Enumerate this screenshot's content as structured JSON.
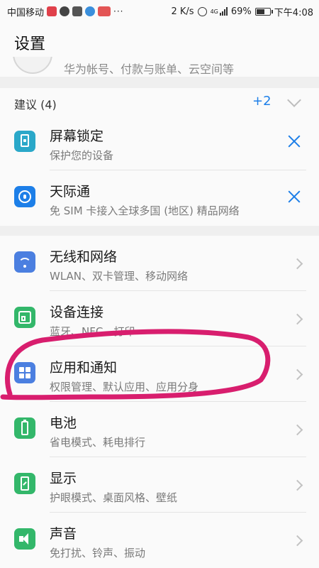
{
  "status_bar": {
    "carrier": "中国移动",
    "speed": "2 K/s",
    "network": "4G",
    "battery": "69%",
    "battery_level": 0.69,
    "time": "下午4:08",
    "more": "···"
  },
  "header": {
    "title": "设置"
  },
  "account": {
    "subtitle": "华为帐号、付款与账单、云空间等"
  },
  "suggestions": {
    "title": "建议 (4)",
    "more_label": "+2",
    "items": [
      {
        "title": "屏幕锁定",
        "subtitle": "保护您的设备",
        "icon": "screen-lock-icon",
        "color": "#2aa8c9"
      },
      {
        "title": "天际通",
        "subtitle": "免 SIM 卡接入全球多国 (地区) 精品网络",
        "icon": "globe-icon",
        "color": "#1d7fe8"
      }
    ]
  },
  "settings": {
    "items": [
      {
        "title": "无线和网络",
        "subtitle": "WLAN、双卡管理、移动网络",
        "icon": "wifi-icon",
        "color": "#4b7fe0"
      },
      {
        "title": "设备连接",
        "subtitle": "蓝牙、NFC、打印",
        "icon": "device-connection-icon",
        "color": "#33b76a"
      },
      {
        "title": "应用和通知",
        "subtitle": "权限管理、默认应用、应用分身",
        "icon": "apps-icon",
        "color": "#4b7fe0"
      },
      {
        "title": "电池",
        "subtitle": "省电模式、耗电排行",
        "icon": "battery-icon",
        "color": "#33b76a"
      },
      {
        "title": "显示",
        "subtitle": "护眼模式、桌面风格、壁纸",
        "icon": "display-icon",
        "color": "#33b76a"
      },
      {
        "title": "声音",
        "subtitle": "免打扰、铃声、振动",
        "icon": "sound-icon",
        "color": "#33b76a"
      }
    ]
  },
  "annotation": {
    "color": "#d81e6e"
  }
}
